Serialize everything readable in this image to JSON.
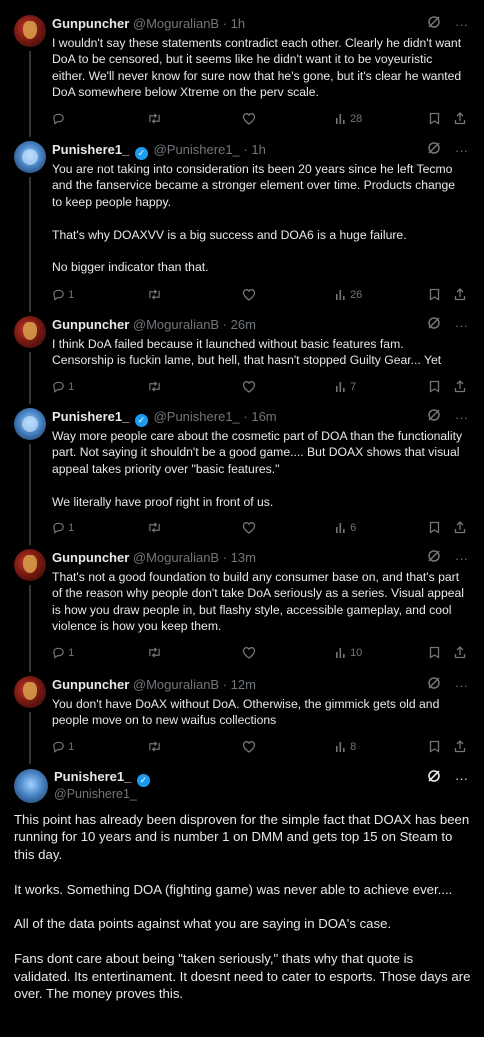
{
  "replies": [
    {
      "name": "Gunpuncher",
      "handle": "@MoguralianB",
      "time": "· 1h",
      "verified": false,
      "avatar": "gunpuncher-avatar",
      "text": "I wouldn't say these statements contradict each other. Clearly he didn't want DoA to be censored, but it seems like he didn't want it to be voyeuristic either. We'll never know for sure now that he's gone, but it's clear he wanted DoA somewhere below Xtreme on the perv scale.",
      "replies_count": "",
      "retweets": "",
      "likes": "",
      "views": "28"
    },
    {
      "name": "Punishere1_",
      "handle": "@Punishere1_",
      "time": "· 1h",
      "verified": true,
      "avatar": "punishere-avatar",
      "text": "You are not taking into consideration its been 20 years since he left Tecmo and the fanservice became a stronger element over time. Products change to keep people happy.\n\nThat's why DOAXVV is a big success and DOA6 is a huge failure.\n\nNo bigger indicator than that.",
      "replies_count": "1",
      "retweets": "",
      "likes": "",
      "views": "26"
    },
    {
      "name": "Gunpuncher",
      "handle": "@MoguralianB",
      "time": "· 26m",
      "verified": false,
      "avatar": "gunpuncher-avatar",
      "text": "I think DoA failed because it launched without basic features fam. Censorship is fuckin lame, but hell, that hasn't stopped Guilty Gear... Yet",
      "replies_count": "1",
      "retweets": "",
      "likes": "",
      "views": "7"
    },
    {
      "name": "Punishere1_",
      "handle": "@Punishere1_",
      "time": "· 16m",
      "verified": true,
      "avatar": "punishere-avatar",
      "text": "Way more people care about the cosmetic part of DOA than the functionality part. Not saying it shouldn't be a good game.... But DOAX shows that visual appeal takes priority over \"basic features.\"\n\nWe literally have proof right in front of us.",
      "replies_count": "1",
      "retweets": "",
      "likes": "",
      "views": "6"
    },
    {
      "name": "Gunpuncher",
      "handle": "@MoguralianB",
      "time": "· 13m",
      "verified": false,
      "avatar": "gunpuncher-avatar",
      "text": "That's not a good foundation to build any consumer base on, and that's part of the reason why people don't take DoA seriously as a series. Visual appeal is how you draw people in, but flashy style, accessible gameplay, and cool violence is how you keep them.",
      "replies_count": "1",
      "retweets": "",
      "likes": "",
      "views": "10"
    },
    {
      "name": "Gunpuncher",
      "handle": "@MoguralianB",
      "time": "· 12m",
      "verified": false,
      "avatar": "gunpuncher-avatar",
      "text": "You don't have DoAX without DoA. Otherwise, the gimmick gets old and people move on to new waifus collections",
      "replies_count": "1",
      "retweets": "",
      "likes": "",
      "views": "8"
    }
  ],
  "main_tweet": {
    "name": "Punishere1_",
    "handle": "@Punishere1_",
    "verified": true,
    "text": "This point has already been disproven for the simple fact that DOAX has been running for 10 years and is number 1 on DMM and gets top 15 on Steam to this day.\n\nIt works. Something DOA (fighting game) was never able to achieve ever....\n\nAll of the data points against what you are saying in DOA's case.\n\nFans dont care about being \"taken seriously,\" thats why that quote is validated. Its entertinament. It doesnt need to cater to esports. Those days are over. The money proves this."
  },
  "icons": {
    "reply": "reply-icon",
    "retweet": "retweet-icon",
    "like": "heart-icon",
    "views": "views-icon",
    "bookmark": "bookmark-icon",
    "share": "share-icon",
    "grok": "grok-icon",
    "more": "more-icon"
  },
  "colors": {
    "background": "#000000",
    "text": "#e7e9ea",
    "secondary": "#71767b",
    "verified": "#1d9bf0",
    "divider": "#2f3336"
  }
}
